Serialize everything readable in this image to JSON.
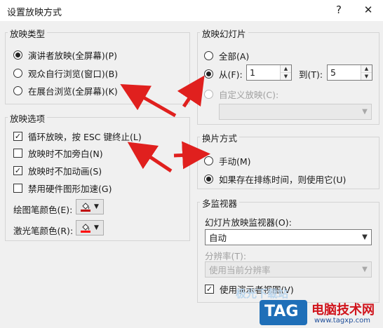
{
  "window": {
    "title": "设置放映方式",
    "help_label": "?",
    "close_label": "✕"
  },
  "show_type": {
    "legend": "放映类型",
    "options": [
      {
        "label": "演讲者放映(全屏幕)(P)",
        "selected": true
      },
      {
        "label": "观众自行浏览(窗口)(B)",
        "selected": false
      },
      {
        "label": "在展台浏览(全屏幕)(K)",
        "selected": false
      }
    ]
  },
  "show_options": {
    "legend": "放映选项",
    "checks": [
      {
        "label": "循环放映，按 ESC 键终止(L)",
        "checked": true
      },
      {
        "label": "放映时不加旁白(N)",
        "checked": false
      },
      {
        "label": "放映时不加动画(S)",
        "checked": true
      },
      {
        "label": "禁用硬件图形加速(G)",
        "checked": false
      }
    ],
    "pen_color_label": "绘图笔颜色(E):",
    "laser_color_label": "激光笔颜色(R):",
    "pen_color": "#c00000",
    "laser_color": "#ff0000"
  },
  "slides": {
    "legend": "放映幻灯片",
    "all_label": "全部(A)",
    "from_label": "从(F):",
    "from_value": "1",
    "to_label": "到(T):",
    "to_value": "5",
    "custom_label": "自定义放映(C):",
    "custom_value": ""
  },
  "advance": {
    "legend": "换片方式",
    "manual_label": "手动(M)",
    "timed_label": "如果存在排练时间，则使用它(U)"
  },
  "monitors": {
    "legend": "多监视器",
    "monitor_label": "幻灯片放映监视器(O):",
    "monitor_value": "自动",
    "resolution_label": "分辨率(T):",
    "resolution_value": "使用当前分辨率",
    "presenter_view_label": "使用演示者视图(V)"
  },
  "watermark": {
    "badge": "TAG",
    "site_name": "电脑技术网",
    "site_url": "www.tagxp.com",
    "faded_text": "极光下载站"
  },
  "colors": {
    "arrow": "#e0201e",
    "badge": "#1f6fb8",
    "site_name": "#d0141c"
  }
}
